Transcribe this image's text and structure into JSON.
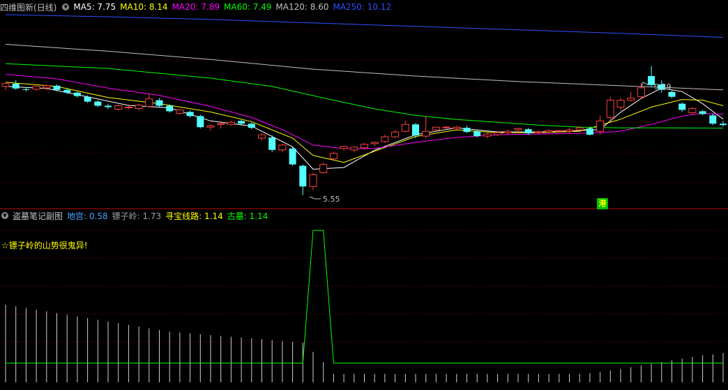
{
  "main_pane": {
    "title": "四维图新(日线)",
    "indicators": [
      {
        "label": "MA5: 7.75",
        "color": "#ffffff"
      },
      {
        "label": "MA10: 8.14",
        "color": "#ffff00"
      },
      {
        "label": "MA20: 7.89",
        "color": "#ff00ff"
      },
      {
        "label": "MA60: 7.49",
        "color": "#00ff00"
      },
      {
        "label": "MA120: 8.60",
        "color": "#c0c0c0"
      },
      {
        "label": "MA250: 10.12",
        "color": "#3050ff"
      }
    ],
    "high_label": "9.29",
    "low_label": "5.55",
    "badge": "港"
  },
  "sub_pane": {
    "title": "盗墓笔记副图",
    "indicators": [
      {
        "label": "地宫: 0.58",
        "color": "#4aa3ff"
      },
      {
        "label": "镖子岭: 1.73",
        "color": "#a0a0a0"
      },
      {
        "label": "寻宝线路: 1.14",
        "color": "#ffff00"
      },
      {
        "label": "古墓: 1.14",
        "color": "#00ff00"
      }
    ],
    "note": "☆镖子岭的山势很鬼异!"
  },
  "colors": {
    "up": "#ff4040",
    "down": "#54ffff",
    "grid": "#800000",
    "divider": "#c00000"
  },
  "chart_data": [
    {
      "type": "candlestick",
      "title": "四维图新(日线)",
      "series_names": [
        "MA5",
        "MA10",
        "MA20",
        "MA60",
        "MA120",
        "MA250"
      ],
      "last_values": {
        "MA5": 7.75,
        "MA10": 8.14,
        "MA20": 7.89,
        "MA60": 7.49,
        "MA120": 8.6,
        "MA250": 10.12
      },
      "marked_high": 9.29,
      "marked_low": 5.55,
      "ylim": [
        5.3,
        10.8
      ],
      "candles": [
        [
          8.7,
          8.82,
          8.6,
          8.78
        ],
        [
          8.78,
          8.88,
          8.6,
          8.64
        ],
        [
          8.62,
          8.68,
          8.55,
          8.6
        ],
        [
          8.62,
          8.72,
          8.58,
          8.7
        ],
        [
          8.66,
          8.76,
          8.6,
          8.72
        ],
        [
          8.72,
          8.76,
          8.56,
          8.6
        ],
        [
          8.6,
          8.66,
          8.48,
          8.52
        ],
        [
          8.52,
          8.56,
          8.38,
          8.42
        ],
        [
          8.4,
          8.44,
          8.22,
          8.26
        ],
        [
          8.26,
          8.3,
          8.1,
          8.14
        ],
        [
          8.14,
          8.2,
          8.04,
          8.1
        ],
        [
          8.04,
          8.18,
          8.0,
          8.14
        ],
        [
          8.1,
          8.18,
          8.04,
          8.1
        ],
        [
          8.06,
          8.2,
          8.0,
          8.16
        ],
        [
          8.12,
          8.5,
          8.1,
          8.34
        ],
        [
          8.3,
          8.36,
          8.1,
          8.14
        ],
        [
          8.14,
          8.18,
          7.94,
          7.98
        ],
        [
          7.92,
          8.04,
          7.88,
          8.02
        ],
        [
          7.96,
          8.0,
          7.8,
          7.84
        ],
        [
          7.84,
          7.88,
          7.48,
          7.52
        ],
        [
          7.52,
          7.6,
          7.42,
          7.56
        ],
        [
          7.6,
          7.66,
          7.48,
          7.62
        ],
        [
          7.6,
          7.7,
          7.56,
          7.66
        ],
        [
          7.7,
          7.74,
          7.56,
          7.62
        ],
        [
          7.62,
          7.66,
          7.46,
          7.5
        ],
        [
          7.2,
          7.34,
          7.14,
          7.3
        ],
        [
          7.22,
          7.28,
          6.8,
          6.86
        ],
        [
          6.86,
          7.04,
          6.8,
          7.0
        ],
        [
          6.9,
          6.94,
          6.4,
          6.44
        ],
        [
          6.4,
          6.44,
          5.55,
          5.8
        ],
        [
          5.8,
          6.2,
          5.7,
          6.14
        ],
        [
          6.2,
          6.5,
          6.18,
          6.44
        ],
        [
          6.6,
          6.8,
          6.54,
          6.76
        ],
        [
          6.9,
          6.98,
          6.84,
          6.96
        ],
        [
          6.86,
          6.96,
          6.8,
          6.94
        ],
        [
          6.92,
          7.06,
          6.88,
          7.02
        ],
        [
          7.04,
          7.1,
          6.98,
          7.08
        ],
        [
          7.1,
          7.3,
          7.06,
          7.24
        ],
        [
          7.24,
          7.44,
          7.2,
          7.38
        ],
        [
          7.4,
          7.7,
          7.36,
          7.6
        ],
        [
          7.6,
          7.64,
          7.2,
          7.28
        ],
        [
          7.26,
          7.84,
          7.2,
          7.4
        ],
        [
          7.44,
          7.54,
          7.4,
          7.52
        ],
        [
          7.5,
          7.56,
          7.46,
          7.52
        ],
        [
          7.48,
          7.56,
          7.42,
          7.52
        ],
        [
          7.5,
          7.56,
          7.34,
          7.38
        ],
        [
          7.4,
          7.44,
          7.22,
          7.26
        ],
        [
          7.26,
          7.36,
          7.2,
          7.32
        ],
        [
          7.3,
          7.4,
          7.26,
          7.36
        ],
        [
          7.36,
          7.44,
          7.3,
          7.4
        ],
        [
          7.44,
          7.5,
          7.36,
          7.48
        ],
        [
          7.46,
          7.5,
          7.3,
          7.34
        ],
        [
          7.36,
          7.42,
          7.32,
          7.38
        ],
        [
          7.38,
          7.46,
          7.34,
          7.42
        ],
        [
          7.4,
          7.44,
          7.36,
          7.42
        ],
        [
          7.4,
          7.5,
          7.34,
          7.44
        ],
        [
          7.44,
          7.56,
          7.42,
          7.5
        ],
        [
          7.48,
          7.52,
          7.28,
          7.3
        ],
        [
          7.4,
          7.86,
          7.3,
          7.7
        ],
        [
          7.8,
          8.4,
          7.72,
          8.3
        ],
        [
          8.1,
          8.36,
          8.0,
          8.3
        ],
        [
          8.3,
          8.54,
          8.26,
          8.36
        ],
        [
          8.4,
          8.8,
          8.34,
          8.66
        ],
        [
          9.0,
          9.29,
          8.7,
          8.74
        ],
        [
          8.76,
          8.88,
          8.52,
          8.6
        ],
        [
          8.54,
          8.58,
          8.36,
          8.4
        ],
        [
          8.2,
          8.24,
          7.96,
          8.02
        ],
        [
          7.94,
          8.1,
          7.88,
          8.06
        ],
        [
          7.98,
          8.02,
          7.86,
          7.9
        ],
        [
          7.86,
          7.92,
          7.58,
          7.62
        ],
        [
          7.62,
          7.7,
          7.54,
          7.58
        ]
      ],
      "ma_lines": {
        "MA5": [
          [
            0,
            8.7
          ],
          [
            4,
            8.64
          ],
          [
            8,
            8.4
          ],
          [
            12,
            8.15
          ],
          [
            16,
            8.08
          ],
          [
            20,
            7.7
          ],
          [
            24,
            7.55
          ],
          [
            28,
            6.95
          ],
          [
            30,
            6.3
          ],
          [
            33,
            6.35
          ],
          [
            36,
            6.85
          ],
          [
            40,
            7.3
          ],
          [
            44,
            7.5
          ],
          [
            48,
            7.38
          ],
          [
            52,
            7.38
          ],
          [
            56,
            7.42
          ],
          [
            58,
            7.45
          ],
          [
            60,
            7.95
          ],
          [
            62,
            8.35
          ],
          [
            64,
            8.65
          ],
          [
            66,
            8.55
          ],
          [
            68,
            8.2
          ],
          [
            70,
            7.75
          ]
        ],
        "MA10": [
          [
            0,
            8.82
          ],
          [
            5,
            8.7
          ],
          [
            10,
            8.38
          ],
          [
            15,
            8.2
          ],
          [
            20,
            7.96
          ],
          [
            24,
            7.68
          ],
          [
            28,
            7.2
          ],
          [
            30,
            6.7
          ],
          [
            33,
            6.5
          ],
          [
            36,
            6.82
          ],
          [
            40,
            7.25
          ],
          [
            44,
            7.44
          ],
          [
            48,
            7.36
          ],
          [
            52,
            7.36
          ],
          [
            56,
            7.4
          ],
          [
            60,
            7.75
          ],
          [
            63,
            8.1
          ],
          [
            66,
            8.32
          ],
          [
            68,
            8.3
          ],
          [
            70,
            8.14
          ]
        ],
        "MA20": [
          [
            0,
            9.05
          ],
          [
            5,
            8.92
          ],
          [
            10,
            8.65
          ],
          [
            15,
            8.44
          ],
          [
            20,
            8.12
          ],
          [
            24,
            7.8
          ],
          [
            27,
            7.45
          ],
          [
            30,
            7.0
          ],
          [
            33,
            6.9
          ],
          [
            36,
            6.9
          ],
          [
            40,
            7.08
          ],
          [
            44,
            7.22
          ],
          [
            48,
            7.3
          ],
          [
            52,
            7.32
          ],
          [
            56,
            7.34
          ],
          [
            58,
            7.36
          ],
          [
            60,
            7.4
          ],
          [
            63,
            7.6
          ],
          [
            66,
            7.84
          ],
          [
            68,
            7.92
          ],
          [
            70,
            7.89
          ]
        ],
        "MA60": [
          [
            0,
            9.36
          ],
          [
            10,
            9.22
          ],
          [
            20,
            8.94
          ],
          [
            26,
            8.7
          ],
          [
            32,
            8.3
          ],
          [
            36,
            8.05
          ],
          [
            40,
            7.86
          ],
          [
            44,
            7.74
          ],
          [
            48,
            7.66
          ],
          [
            52,
            7.58
          ],
          [
            56,
            7.52
          ],
          [
            60,
            7.5
          ],
          [
            64,
            7.5
          ],
          [
            70,
            7.49
          ]
        ],
        "MA120": [
          [
            0,
            9.92
          ],
          [
            10,
            9.72
          ],
          [
            20,
            9.48
          ],
          [
            30,
            9.2
          ],
          [
            40,
            9.0
          ],
          [
            50,
            8.84
          ],
          [
            60,
            8.72
          ],
          [
            65,
            8.66
          ],
          [
            70,
            8.6
          ]
        ],
        "MA250": [
          [
            0,
            10.78
          ],
          [
            10,
            10.72
          ],
          [
            20,
            10.64
          ],
          [
            30,
            10.54
          ],
          [
            40,
            10.44
          ],
          [
            50,
            10.34
          ],
          [
            60,
            10.24
          ],
          [
            70,
            10.12
          ]
        ]
      }
    },
    {
      "type": "line",
      "title": "盗墓笔记副图",
      "series_names": [
        "地宫",
        "镖子岭",
        "寻宝线路",
        "古墓"
      ],
      "last_values": {
        "地宫": 0.58,
        "镖子岭": 1.73,
        "寻宝线路": 1.14,
        "古墓": 1.14
      },
      "ylim": [
        0,
        9.5
      ],
      "series": [
        {
          "name": "镖子岭",
          "display": "sticks",
          "values": [
            4.6,
            4.5,
            4.4,
            4.3,
            4.2,
            4.1,
            4.0,
            3.9,
            3.8,
            3.7,
            3.6,
            3.5,
            3.4,
            3.3,
            3.2,
            3.1,
            3.0,
            2.95,
            2.9,
            2.85,
            2.8,
            2.75,
            2.7,
            2.65,
            2.6,
            2.55,
            2.5,
            2.45,
            2.4,
            2.35,
            1.8,
            1.2,
            0.5,
            0.5,
            0.5,
            0.5,
            0.5,
            0.5,
            0.5,
            0.5,
            0.5,
            0.5,
            0.5,
            0.5,
            0.5,
            0.5,
            0.5,
            0.5,
            0.5,
            0.5,
            0.5,
            0.5,
            0.5,
            0.5,
            0.5,
            0.5,
            0.5,
            0.55,
            0.6,
            0.7,
            0.8,
            0.9,
            1.0,
            1.1,
            1.2,
            1.3,
            1.4,
            1.5,
            1.6,
            1.65,
            1.73
          ]
        },
        {
          "name": "古墓",
          "display": "line",
          "values": [
            [
              0,
              1.14
            ],
            [
              29,
              1.14
            ],
            [
              30,
              9.0
            ],
            [
              31,
              9.0
            ],
            [
              32,
              1.14
            ],
            [
              70,
              1.14
            ]
          ]
        }
      ]
    }
  ]
}
